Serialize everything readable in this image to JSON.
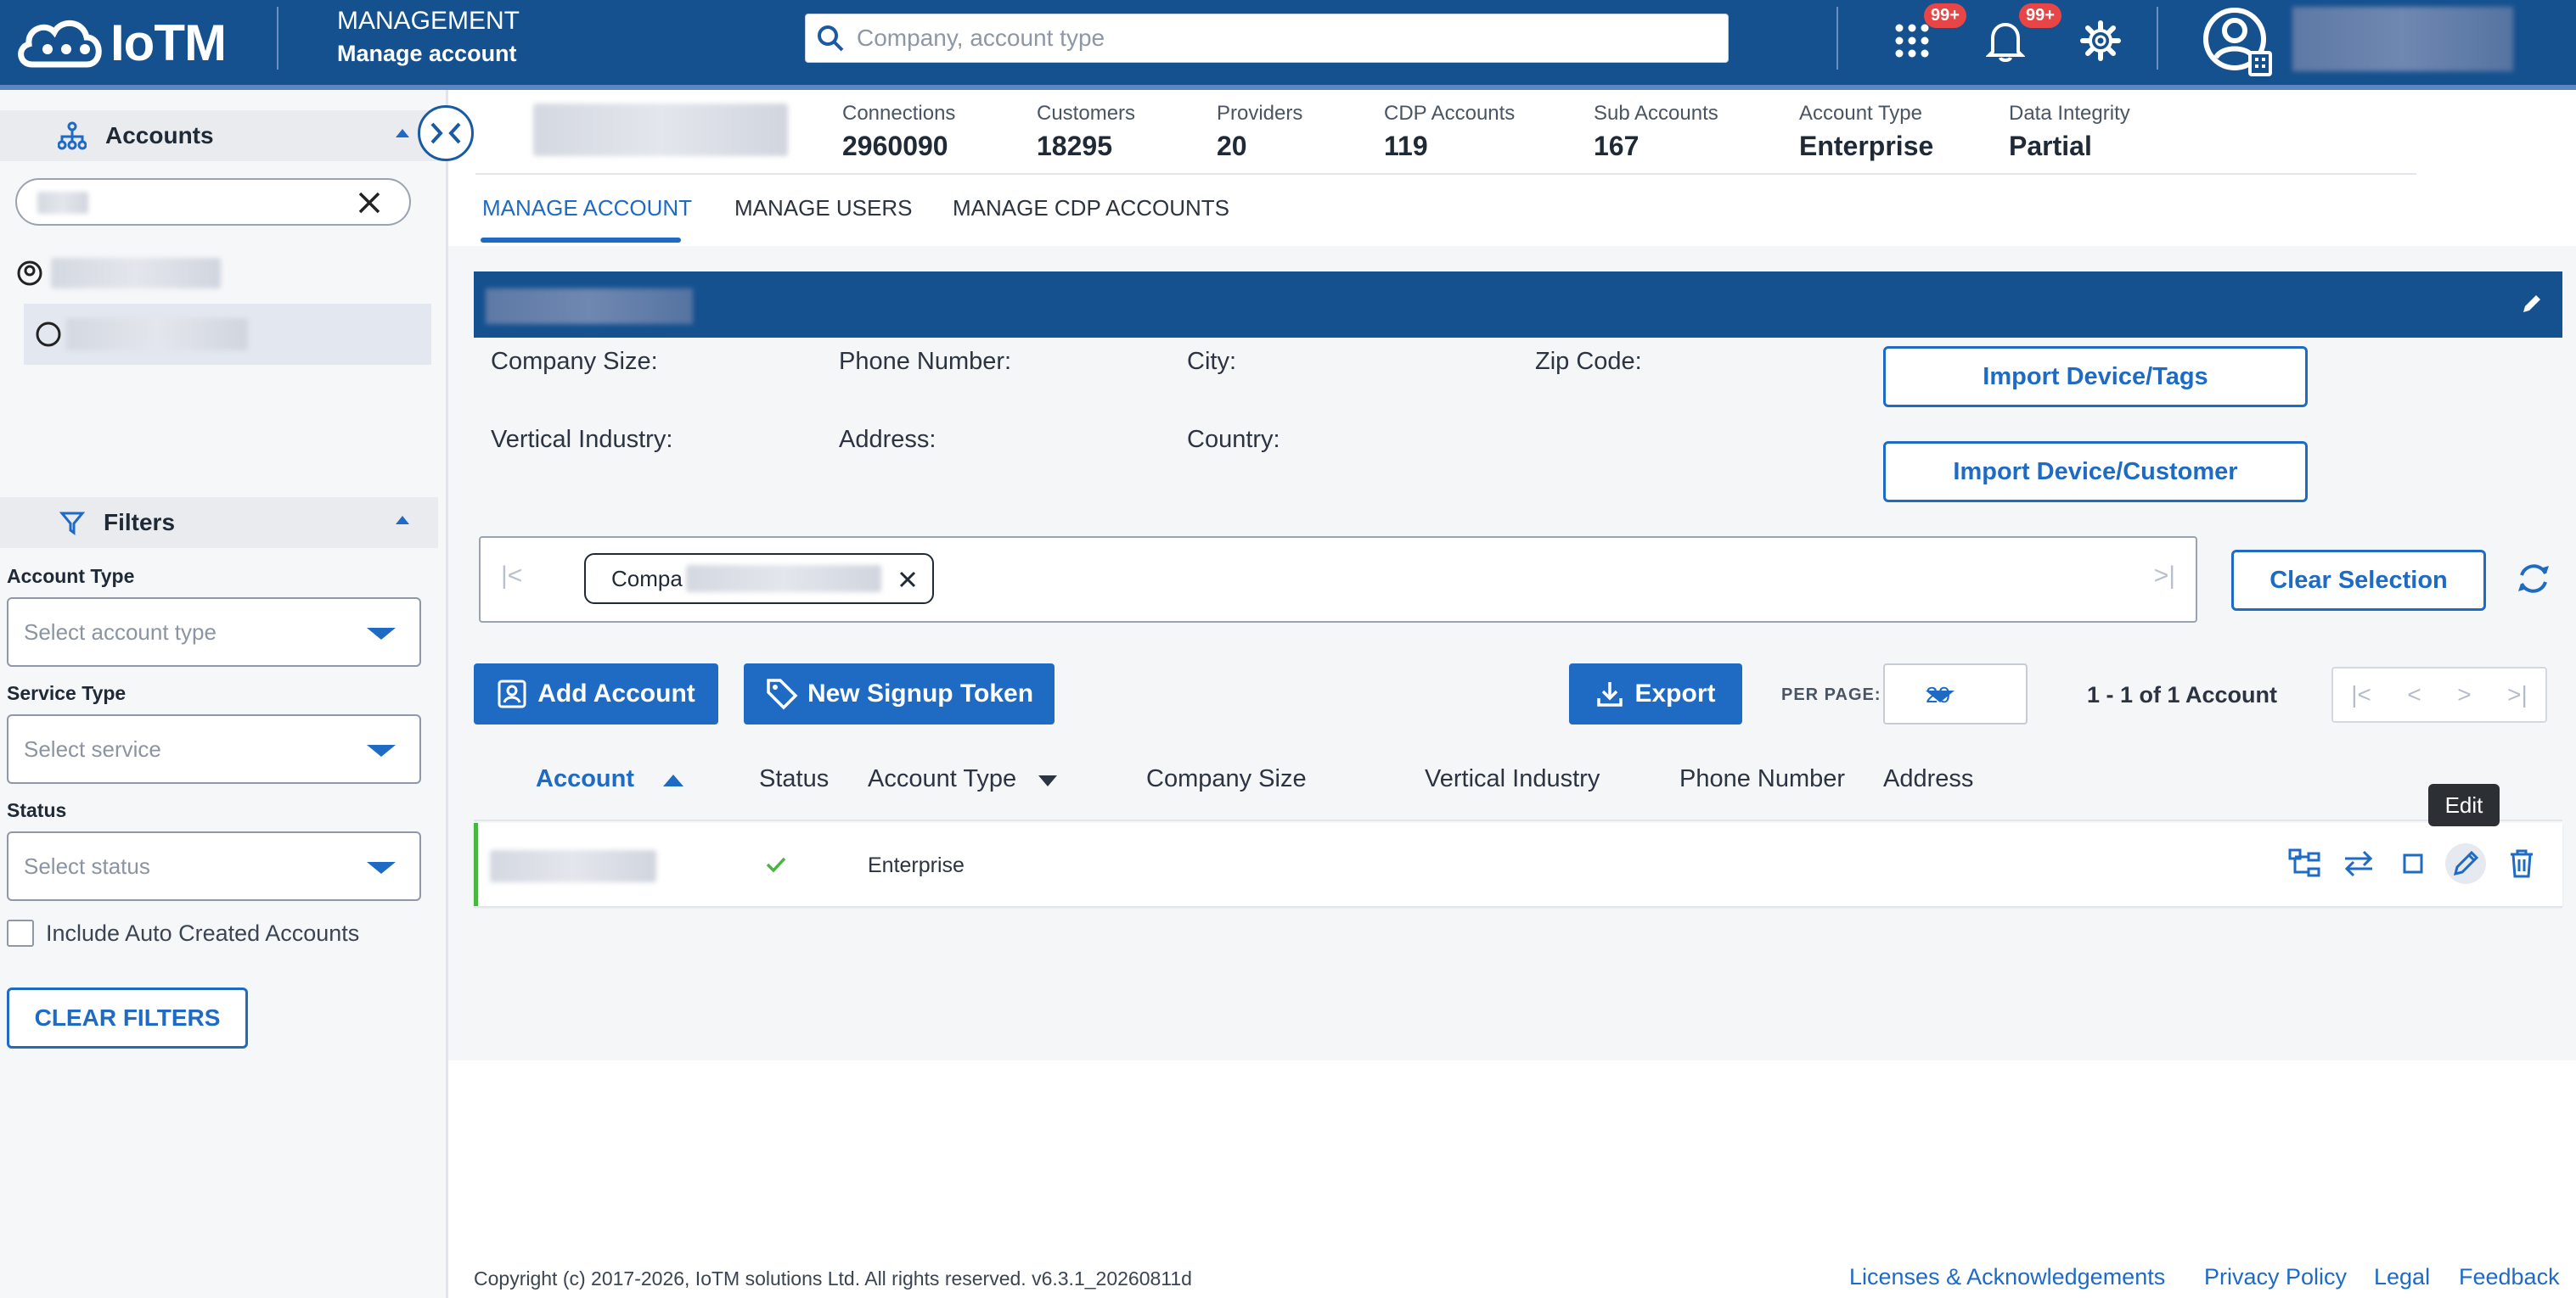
{
  "header": {
    "logo_text": "IoTM",
    "section_title": "MANAGEMENT",
    "section_subtitle": "Manage account",
    "search_placeholder": "Company, account type",
    "apps_badge": "99+",
    "notifications_badge": "99+"
  },
  "sidebar": {
    "accounts_title": "Accounts",
    "filters_title": "Filters",
    "filters": [
      {
        "label": "Account Type",
        "placeholder": "Select account type"
      },
      {
        "label": "Service Type",
        "placeholder": "Select service"
      },
      {
        "label": "Status",
        "placeholder": "Select status"
      }
    ],
    "include_auto_label": "Include Auto Created Accounts",
    "clear_filters_label": "CLEAR FILTERS"
  },
  "stats": [
    {
      "label": "Connections",
      "value": "2960090"
    },
    {
      "label": "Customers",
      "value": "18295"
    },
    {
      "label": "Providers",
      "value": "20"
    },
    {
      "label": "CDP Accounts",
      "value": "119"
    },
    {
      "label": "Sub Accounts",
      "value": "167"
    },
    {
      "label": "Account Type",
      "value": "Enterprise"
    },
    {
      "label": "Data Integrity",
      "value": "Partial"
    }
  ],
  "tabs": [
    "MANAGE ACCOUNT",
    "MANAGE USERS",
    "MANAGE CDP ACCOUNTS"
  ],
  "details": {
    "fields": [
      "Company Size:",
      "Phone Number:",
      "City:",
      "Zip Code:",
      "Vertical Industry:",
      "Address:",
      "Country:"
    ],
    "import_tags_label": "Import Device/Tags",
    "import_customer_label": "Import Device/Customer"
  },
  "breadcrumb": {
    "chip_text": "Compa"
  },
  "actions": {
    "clear_selection_label": "Clear Selection",
    "add_account_label": "Add Account",
    "new_signup_token_label": "New Signup Token",
    "export_label": "Export",
    "per_page_label": "PER PAGE:",
    "per_page_value": "20",
    "range_text": "1 - 1 of 1 Account"
  },
  "table": {
    "columns": [
      "Account",
      "Status",
      "Account Type",
      "Company Size",
      "Vertical Industry",
      "Phone Number",
      "Address"
    ],
    "rows": [
      {
        "account_type": "Enterprise",
        "status": "active"
      }
    ],
    "tooltip": "Edit"
  },
  "footer": {
    "copyright": "Copyright (c) 2017-2026, IoTM solutions Ltd. All rights reserved. v6.3.1_20260811d",
    "links": [
      "Licenses & Acknowledgements",
      "Privacy Policy",
      "Legal",
      "Feedback"
    ]
  },
  "colors": {
    "brand": "#16518f",
    "accent": "#1f6bc4",
    "active_status": "#4bb542",
    "badge": "#e84646"
  }
}
